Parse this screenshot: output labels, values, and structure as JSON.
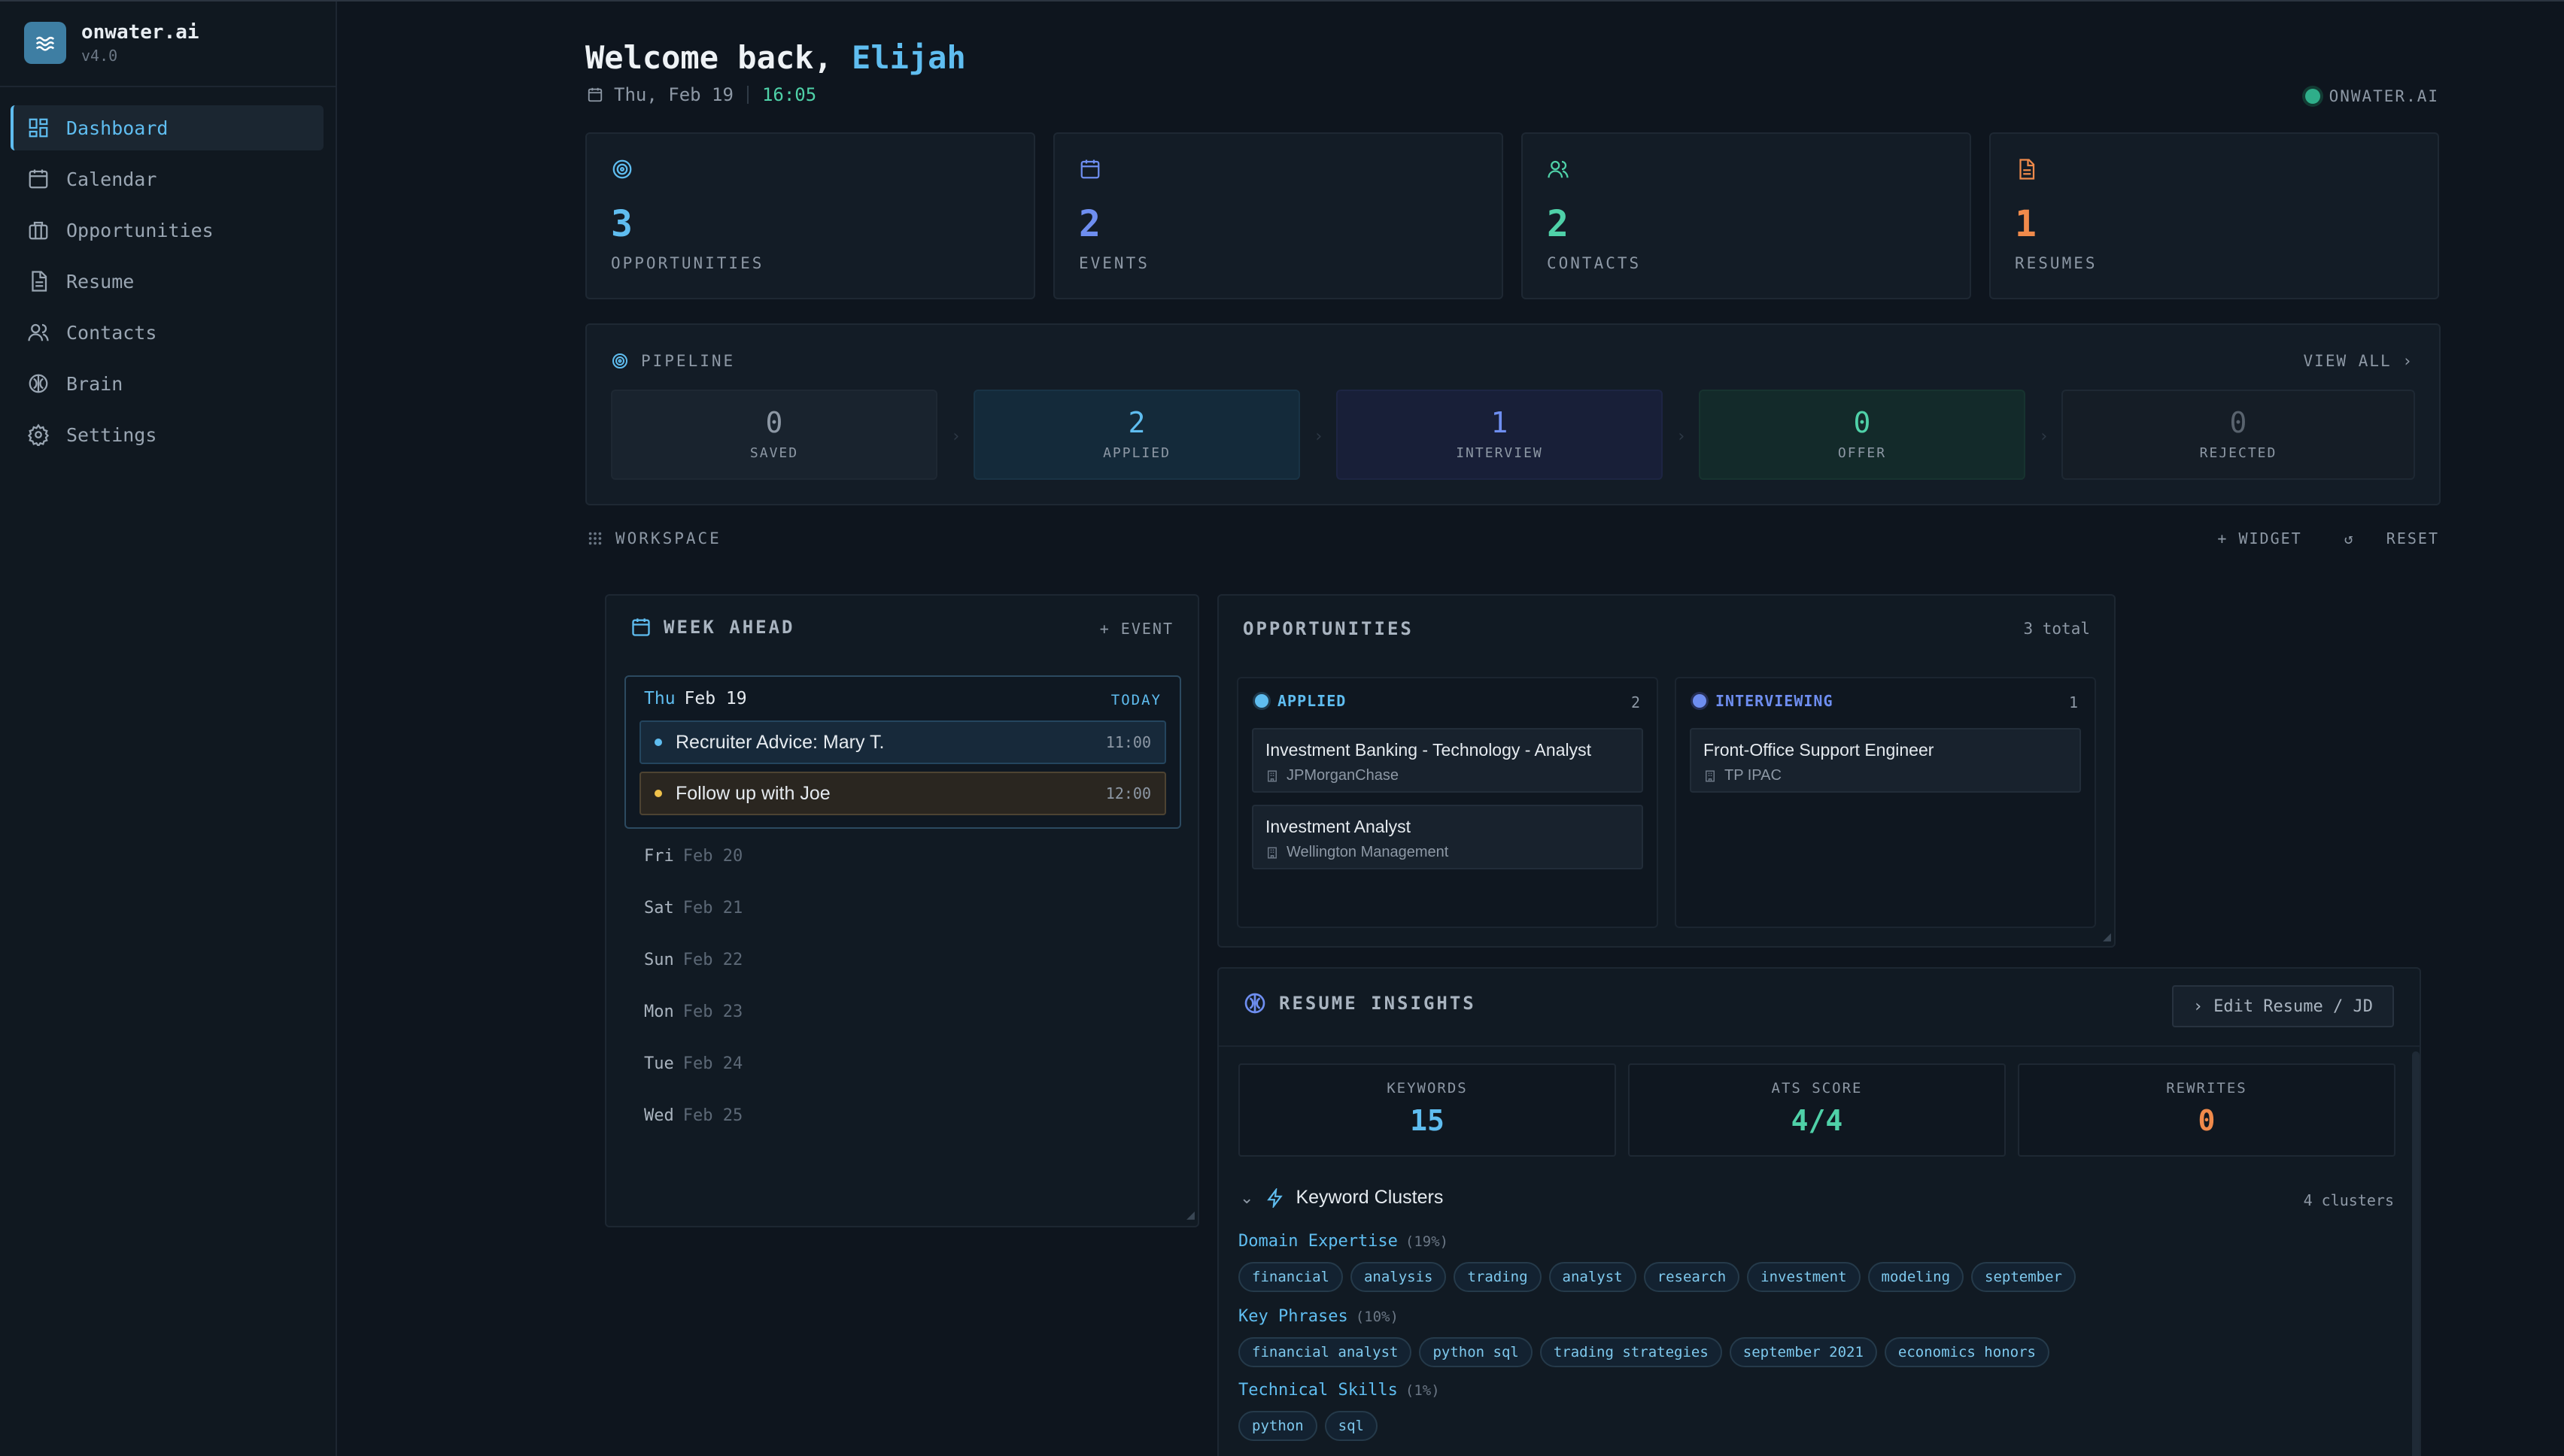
{
  "app": {
    "name": "onwater.ai",
    "version": "v4.0"
  },
  "sidebar": {
    "items": [
      {
        "label": "Dashboard",
        "icon": "grid-icon",
        "active": true
      },
      {
        "label": "Calendar",
        "icon": "calendar-icon"
      },
      {
        "label": "Opportunities",
        "icon": "briefcase-icon"
      },
      {
        "label": "Resume",
        "icon": "document-icon"
      },
      {
        "label": "Contacts",
        "icon": "users-icon"
      },
      {
        "label": "Brain",
        "icon": "brain-icon"
      },
      {
        "label": "Settings",
        "icon": "gear-icon"
      }
    ]
  },
  "header": {
    "welcome": "Welcome back,",
    "name": "Elijah",
    "date": "Thu, Feb 19",
    "time": "16:05",
    "brand": "ONWATER.AI"
  },
  "stats": [
    {
      "value": "3",
      "label": "OPPORTUNITIES",
      "icon": "target-icon",
      "color": "#5fbdf0"
    },
    {
      "value": "2",
      "label": "EVENTS",
      "icon": "calendar-icon",
      "color": "#6e8ef0"
    },
    {
      "value": "2",
      "label": "CONTACTS",
      "icon": "users-icon",
      "color": "#4fd1a8"
    },
    {
      "value": "1",
      "label": "RESUMES",
      "icon": "document-icon",
      "color": "#f08a4b"
    }
  ],
  "pipeline": {
    "title": "PIPELINE",
    "view_all": "VIEW ALL",
    "stages": [
      {
        "value": "0",
        "label": "SAVED"
      },
      {
        "value": "2",
        "label": "APPLIED"
      },
      {
        "value": "1",
        "label": "INTERVIEW"
      },
      {
        "value": "0",
        "label": "OFFER"
      },
      {
        "value": "0",
        "label": "REJECTED"
      }
    ]
  },
  "workspace": {
    "label": "WORKSPACE",
    "add_widget": "+ WIDGET",
    "reset": "RESET"
  },
  "week": {
    "title": "WEEK AHEAD",
    "add_event": "+ EVENT",
    "today": {
      "dow": "Thu",
      "date": "Feb 19",
      "tag": "TODAY"
    },
    "events": [
      {
        "title": "Recruiter Advice: Mary T.",
        "time": "11:00"
      },
      {
        "title": "Follow up with Joe",
        "time": "12:00"
      }
    ],
    "days": [
      {
        "dow": "Fri",
        "date": "Feb 20"
      },
      {
        "dow": "Sat",
        "date": "Feb 21"
      },
      {
        "dow": "Sun",
        "date": "Feb 22"
      },
      {
        "dow": "Mon",
        "date": "Feb 23"
      },
      {
        "dow": "Tue",
        "date": "Feb 24"
      },
      {
        "dow": "Wed",
        "date": "Feb 25"
      }
    ]
  },
  "opportunities": {
    "title": "OPPORTUNITIES",
    "total": "3 total",
    "columns": [
      {
        "label": "APPLIED",
        "count": "2",
        "items": [
          {
            "title": "Investment Banking - Technology - Analyst",
            "company": "JPMorganChase"
          },
          {
            "title": "Investment Analyst",
            "company": "Wellington Management"
          }
        ]
      },
      {
        "label": "INTERVIEWING",
        "count": "1",
        "items": [
          {
            "title": "Front-Office Support Engineer",
            "company": "TP IPAC"
          }
        ]
      }
    ]
  },
  "insights": {
    "title": "RESUME INSIGHTS",
    "edit": "Edit Resume / JD",
    "metrics": [
      {
        "label": "KEYWORDS",
        "value": "15"
      },
      {
        "label": "ATS SCORE",
        "value": "4/4"
      },
      {
        "label": "REWRITES",
        "value": "0"
      }
    ],
    "clusters_title": "Keyword Clusters",
    "clusters_count": "4 clusters",
    "groups": [
      {
        "name": "Domain Expertise",
        "pct": "(19%)",
        "tags": [
          "financial",
          "analysis",
          "trading",
          "analyst",
          "research",
          "investment",
          "modeling",
          "september"
        ]
      },
      {
        "name": "Key Phrases",
        "pct": "(10%)",
        "tags": [
          "financial analyst",
          "python sql",
          "trading strategies",
          "september 2021",
          "economics honors"
        ]
      },
      {
        "name": "Technical Skills",
        "pct": "(1%)",
        "tags": [
          "python",
          "sql"
        ]
      }
    ]
  }
}
